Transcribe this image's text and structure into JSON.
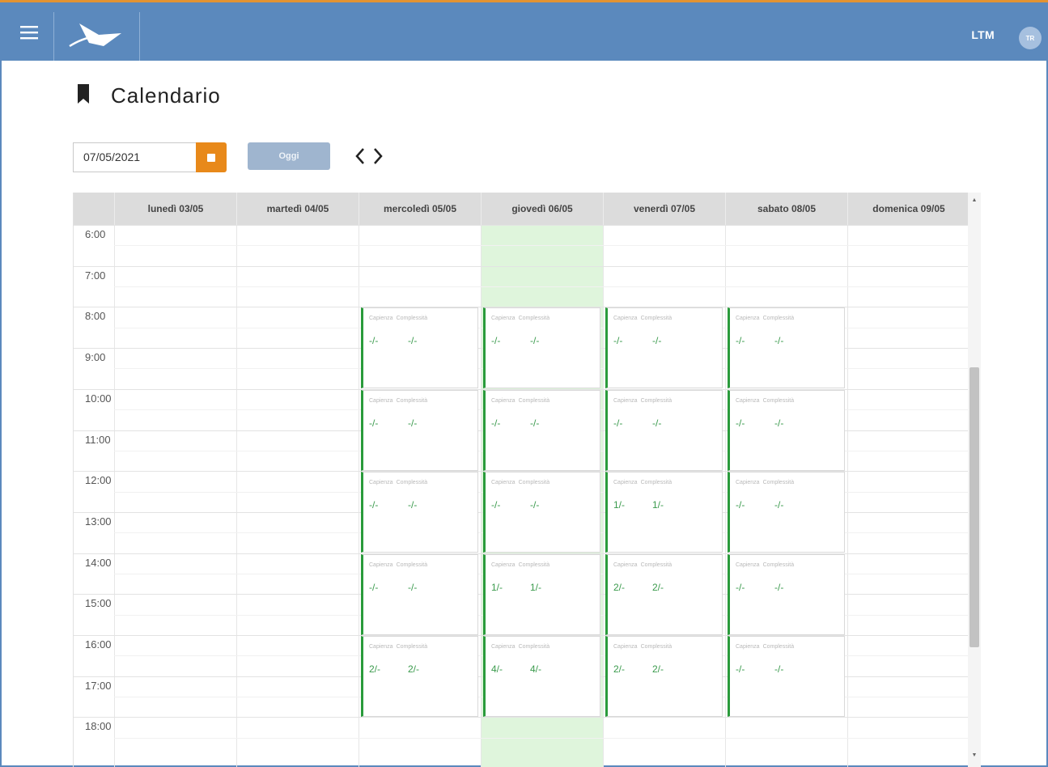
{
  "header": {
    "user_code": "LTM",
    "avatar_initials": "TR",
    "colors": {
      "bar": "#5b89bd",
      "accent_top": "#e39332"
    }
  },
  "page": {
    "title": "Calendario"
  },
  "toolbar": {
    "date_value": "07/05/2021",
    "today_label": "Oggi",
    "prev_glyph": "‹",
    "next_glyph": "›"
  },
  "calendar": {
    "days": [
      {
        "label": "lunedì 03/05"
      },
      {
        "label": "martedì 04/05"
      },
      {
        "label": "mercoledì 05/05"
      },
      {
        "label": "giovedì 06/05"
      },
      {
        "label": "venerdì 07/05"
      },
      {
        "label": "sabato 08/05"
      },
      {
        "label": "domenica 09/05"
      }
    ],
    "highlighted_day_index": 3,
    "hours": [
      "6:00",
      "7:00",
      "8:00",
      "9:00",
      "10:00",
      "11:00",
      "12:00",
      "13:00",
      "14:00",
      "15:00",
      "16:00",
      "17:00",
      "18:00"
    ],
    "event_labels": {
      "capacity": "Capienza",
      "complexity": "Complessità"
    },
    "slots": [
      {
        "day": 2,
        "start": "8:00",
        "capienza": "-/-",
        "complessita": "-/-"
      },
      {
        "day": 3,
        "start": "8:00",
        "capienza": "-/-",
        "complessita": "-/-"
      },
      {
        "day": 4,
        "start": "8:00",
        "capienza": "-/-",
        "complessita": "-/-"
      },
      {
        "day": 5,
        "start": "8:00",
        "capienza": "-/-",
        "complessita": "-/-"
      },
      {
        "day": 2,
        "start": "10:00",
        "capienza": "-/-",
        "complessita": "-/-"
      },
      {
        "day": 3,
        "start": "10:00",
        "capienza": "-/-",
        "complessita": "-/-"
      },
      {
        "day": 4,
        "start": "10:00",
        "capienza": "-/-",
        "complessita": "-/-"
      },
      {
        "day": 5,
        "start": "10:00",
        "capienza": "-/-",
        "complessita": "-/-"
      },
      {
        "day": 2,
        "start": "12:00",
        "capienza": "-/-",
        "complessita": "-/-"
      },
      {
        "day": 3,
        "start": "12:00",
        "capienza": "-/-",
        "complessita": "-/-"
      },
      {
        "day": 4,
        "start": "12:00",
        "capienza": "1/-",
        "complessita": "1/-"
      },
      {
        "day": 5,
        "start": "12:00",
        "capienza": "-/-",
        "complessita": "-/-"
      },
      {
        "day": 2,
        "start": "14:00",
        "capienza": "-/-",
        "complessita": "-/-"
      },
      {
        "day": 3,
        "start": "14:00",
        "capienza": "1/-",
        "complessita": "1/-"
      },
      {
        "day": 4,
        "start": "14:00",
        "capienza": "2/-",
        "complessita": "2/-"
      },
      {
        "day": 5,
        "start": "14:00",
        "capienza": "-/-",
        "complessita": "-/-"
      },
      {
        "day": 2,
        "start": "16:00",
        "capienza": "2/-",
        "complessita": "2/-"
      },
      {
        "day": 3,
        "start": "16:00",
        "capienza": "4/-",
        "complessita": "4/-"
      },
      {
        "day": 4,
        "start": "16:00",
        "capienza": "2/-",
        "complessita": "2/-"
      },
      {
        "day": 5,
        "start": "16:00",
        "capienza": "-/-",
        "complessita": "-/-"
      }
    ]
  }
}
